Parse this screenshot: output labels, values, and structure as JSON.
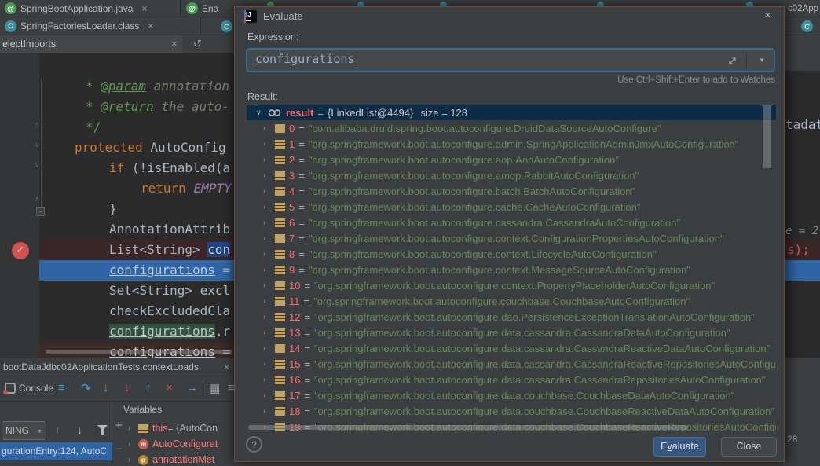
{
  "window": {
    "tabs_row1": [
      "SpringBootApplication.java",
      "Ena"
    ],
    "tabs_row2": [
      "SpringFactoriesLoader.class"
    ],
    "search_value": "electImports",
    "right_tab": "c02App"
  },
  "editor": {
    "lines": [
      {
        "pad": 14,
        "bg": "",
        "tokens": [
          [
            "* ",
            "doc"
          ],
          [
            "@param",
            "doctag"
          ],
          [
            " annotation",
            "docbody"
          ]
        ]
      },
      {
        "pad": 14,
        "bg": "",
        "tokens": [
          [
            "* ",
            "doc"
          ],
          [
            "@return",
            "doctag"
          ],
          [
            " the auto-",
            "docbody"
          ]
        ]
      },
      {
        "pad": 14,
        "bg": "",
        "tokens": [
          [
            "*/",
            "doc"
          ]
        ]
      },
      {
        "pad": 0,
        "bg": "",
        "tokens": [
          [
            "protected ",
            "kw"
          ],
          [
            "AutoConfig",
            "plain"
          ]
        ]
      },
      {
        "pad": 44,
        "bg": "",
        "tokens": [
          [
            "if ",
            "kw"
          ],
          [
            "(!isEnabled(a",
            "plain"
          ]
        ]
      },
      {
        "pad": 84,
        "bg": "",
        "tokens": [
          [
            "return ",
            "kw"
          ],
          [
            "EMPTY",
            "const"
          ]
        ]
      },
      {
        "pad": 44,
        "bg": "",
        "tokens": [
          [
            "}",
            "plain"
          ]
        ]
      },
      {
        "pad": 44,
        "bg": "",
        "tokens": [
          [
            "AnnotationAttrib",
            "plain"
          ]
        ]
      },
      {
        "pad": 44,
        "bg": "bp",
        "tokens": [
          [
            "List<String> ",
            "plain"
          ],
          [
            "con",
            "selu"
          ]
        ]
      },
      {
        "pad": 44,
        "bg": "exec",
        "tokens": [
          [
            "configurations",
            "und"
          ],
          [
            " =",
            "plain"
          ]
        ]
      },
      {
        "pad": 44,
        "bg": "",
        "tokens": [
          [
            "Set<String> excl",
            "plain"
          ]
        ]
      },
      {
        "pad": 44,
        "bg": "",
        "tokens": [
          [
            "checkExcludedCla",
            "plain"
          ]
        ]
      },
      {
        "pad": 44,
        "bg": "",
        "tokens": [
          [
            "configurations",
            "hlu"
          ],
          [
            ".r",
            "plain"
          ]
        ]
      },
      {
        "pad": 44,
        "bg": "bp2",
        "tokens": [
          [
            "configurations",
            "und"
          ],
          [
            " =",
            "plain"
          ]
        ]
      }
    ]
  },
  "debug": {
    "tab": "bootDataJdbc02ApplicationTests.contextLoads",
    "console": "Console",
    "variables_title": "Variables",
    "thread": "NING",
    "frame": "gurationEntry:124, AutoC",
    "vars": [
      {
        "icon": "value",
        "name": "this",
        "rest": " = {AutoCon"
      },
      {
        "icon": "method",
        "name": "AutoConfigurat",
        "rest": ""
      },
      {
        "icon": "param",
        "name": "annotationMet",
        "rest": ""
      }
    ]
  },
  "right_edge": {
    "frag1": "tadat",
    "frag2": "e = 2",
    "frag3": "s);",
    "frag4": "28"
  },
  "dialog": {
    "title": "Evaluate",
    "expression_label": "Expression:",
    "expression_value": "configurations",
    "hint": "Use Ctrl+Shift+Enter to add to Watches",
    "result_label_mn": "R",
    "result_label_rest": "esult:",
    "root": {
      "name": "result",
      "eq": "=",
      "ref": "{LinkedList@4494}",
      "size": "size = 128"
    },
    "eq_sign": "=",
    "items": [
      {
        "i": "0",
        "v": "\"com.alibaba.druid.spring.boot.autoconfigure.DruidDataSourceAutoConfigure\""
      },
      {
        "i": "1",
        "v": "\"org.springframework.boot.autoconfigure.admin.SpringApplicationAdminJmxAutoConfiguration\""
      },
      {
        "i": "2",
        "v": "\"org.springframework.boot.autoconfigure.aop.AopAutoConfiguration\""
      },
      {
        "i": "3",
        "v": "\"org.springframework.boot.autoconfigure.amqp.RabbitAutoConfiguration\""
      },
      {
        "i": "4",
        "v": "\"org.springframework.boot.autoconfigure.batch.BatchAutoConfiguration\""
      },
      {
        "i": "5",
        "v": "\"org.springframework.boot.autoconfigure.cache.CacheAutoConfiguration\""
      },
      {
        "i": "6",
        "v": "\"org.springframework.boot.autoconfigure.cassandra.CassandraAutoConfiguration\""
      },
      {
        "i": "7",
        "v": "\"org.springframework.boot.autoconfigure.context.ConfigurationPropertiesAutoConfiguration\""
      },
      {
        "i": "8",
        "v": "\"org.springframework.boot.autoconfigure.context.LifecycleAutoConfiguration\""
      },
      {
        "i": "9",
        "v": "\"org.springframework.boot.autoconfigure.context.MessageSourceAutoConfiguration\""
      },
      {
        "i": "10",
        "v": "\"org.springframework.boot.autoconfigure.context.PropertyPlaceholderAutoConfiguration\""
      },
      {
        "i": "11",
        "v": "\"org.springframework.boot.autoconfigure.couchbase.CouchbaseAutoConfiguration\""
      },
      {
        "i": "12",
        "v": "\"org.springframework.boot.autoconfigure.dao.PersistenceExceptionTranslationAutoConfiguration\""
      },
      {
        "i": "13",
        "v": "\"org.springframework.boot.autoconfigure.data.cassandra.CassandraDataAutoConfiguration\""
      },
      {
        "i": "14",
        "v": "\"org.springframework.boot.autoconfigure.data.cassandra.CassandraReactiveDataAutoConfiguration\""
      },
      {
        "i": "15",
        "v": "\"org.springframework.boot.autoconfigure.data.cassandra.CassandraReactiveRepositoriesAutoConfiguration\""
      },
      {
        "i": "16",
        "v": "\"org.springframework.boot.autoconfigure.data.cassandra.CassandraRepositoriesAutoConfiguration\""
      },
      {
        "i": "17",
        "v": "\"org.springframework.boot.autoconfigure.data.couchbase.CouchbaseDataAutoConfiguration\""
      },
      {
        "i": "18",
        "v": "\"org.springframework.boot.autoconfigure.data.couchbase.CouchbaseReactiveDataAutoConfiguration\""
      },
      {
        "i": "19",
        "v": "\"org.springframework.boot.autoconfigure.data.couchbase.CouchbaseReactiveRepositoriesAutoConfiguration\""
      }
    ],
    "help": "?",
    "evaluate_pre": "E",
    "evaluate_mn": "v",
    "evaluate_post": "aluate",
    "close": "Close"
  },
  "icons": {
    "close": "×",
    "rotate": "↺",
    "caret": "▼",
    "chev_right": "›",
    "chev_down": "∨",
    "step_over": "↷",
    "step_into": "↓",
    "force_step_into": "↓",
    "step_out": "↑",
    "drop_frame": "×",
    "run_to_cursor": "→",
    "grid": "▦",
    "menu": "≡",
    "up": "↑",
    "down": "↓",
    "plus": "+",
    "minus": "−",
    "check": "✓",
    "at": "@",
    "class_letter": "C",
    "fold_up": "∧",
    "fold_down": "∨",
    "fold_minus": "−"
  },
  "colors": {
    "accent_blue": "#2f65a5",
    "breakpoint_red": "#d25252",
    "string_green": "#6a8759",
    "index_red": "#ff6b68",
    "selection_navy": "#0d2c47",
    "button_blue": "#365880"
  }
}
